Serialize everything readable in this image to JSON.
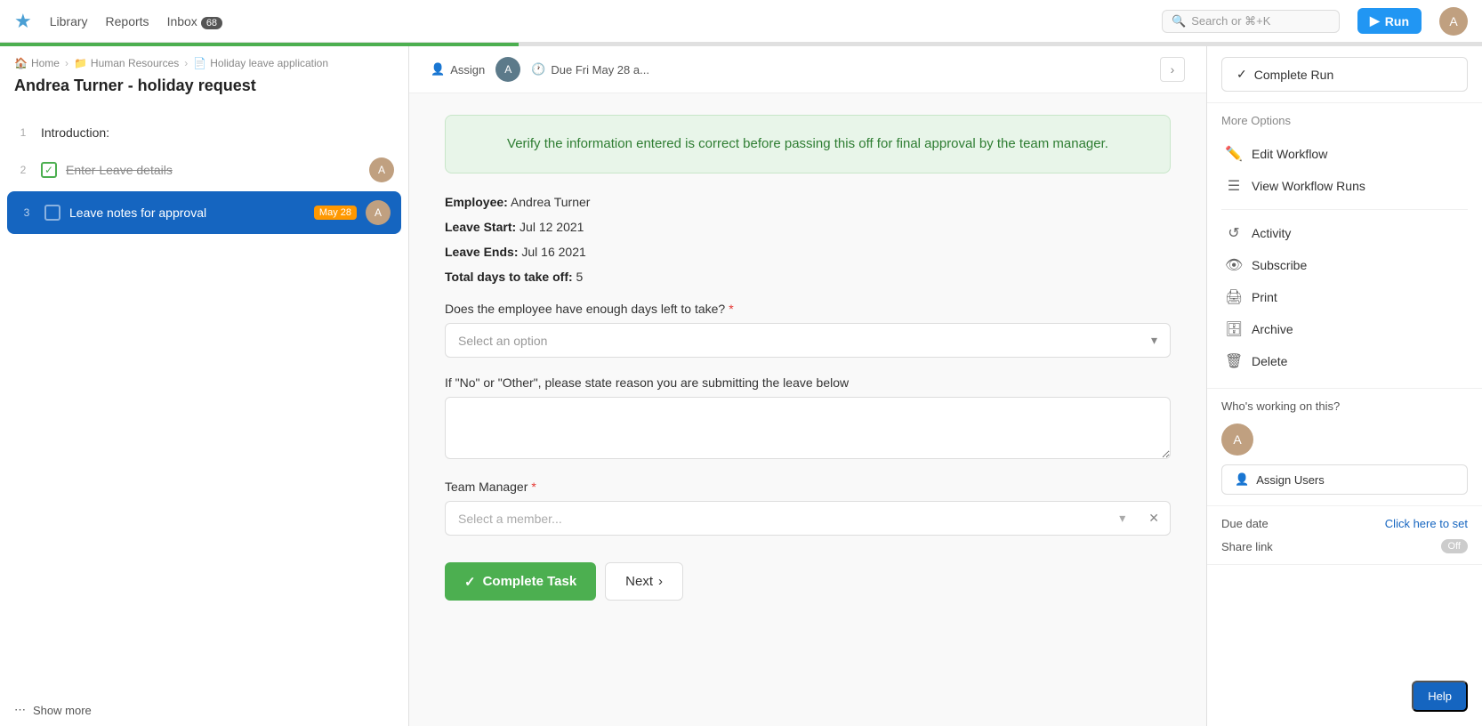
{
  "nav": {
    "logo": "★",
    "links": [
      {
        "label": "Library",
        "id": "library"
      },
      {
        "label": "Reports",
        "id": "reports"
      },
      {
        "label": "Inbox",
        "id": "inbox",
        "badge": "68"
      }
    ],
    "search_placeholder": "Search or ⌘+K",
    "run_label": "Run",
    "user_initial": "A"
  },
  "breadcrumb": {
    "home": "Home",
    "section": "Human Resources",
    "page": "Holiday leave application"
  },
  "page_title": "Andrea Turner - holiday request",
  "steps": [
    {
      "number": "1",
      "label": "Introduction:",
      "completed": false,
      "active": false,
      "checkbox": "none"
    },
    {
      "number": "2",
      "label": "Enter Leave details",
      "completed": true,
      "active": false,
      "checkbox": "checked"
    },
    {
      "number": "3",
      "label": "Leave notes for approval",
      "completed": false,
      "active": true,
      "checkbox": "active",
      "badge": "May 28"
    }
  ],
  "show_more": "Show more",
  "top_bar": {
    "assign_label": "Assign",
    "due_label": "Due Fri May 28 a..."
  },
  "info_banner": {
    "text": "Verify the information entered is correct before passing this off for final approval by the team manager."
  },
  "employee_info": {
    "employee_label": "Employee:",
    "employee_value": "Andrea Turner",
    "leave_start_label": "Leave Start:",
    "leave_start_value": "Jul 12 2021",
    "leave_ends_label": "Leave Ends:",
    "leave_ends_value": "Jul 16 2021",
    "total_days_label": "Total days to take off:",
    "total_days_value": "5"
  },
  "form": {
    "question_label": "Does the employee have enough days left to take?",
    "question_required": true,
    "select_placeholder": "Select an option",
    "reason_label": "If \"No\" or \"Other\", please state reason you are submitting the leave below",
    "reason_placeholder": "",
    "team_manager_label": "Team Manager",
    "team_manager_required": true,
    "member_placeholder": "Select a member...",
    "complete_task_label": "Complete Task",
    "next_label": "Next"
  },
  "right_sidebar": {
    "complete_run_label": "Complete Run",
    "more_options_label": "More Options",
    "menu_items": [
      {
        "id": "edit-workflow",
        "icon": "✏️",
        "label": "Edit Workflow"
      },
      {
        "id": "view-workflow-runs",
        "icon": "☰",
        "label": "View Workflow Runs"
      },
      {
        "id": "activity",
        "icon": "↺",
        "label": "Activity"
      },
      {
        "id": "subscribe",
        "icon": "👁",
        "label": "Subscribe"
      },
      {
        "id": "print",
        "icon": "🖨",
        "label": "Print"
      },
      {
        "id": "archive",
        "icon": "🗄",
        "label": "Archive"
      },
      {
        "id": "delete",
        "icon": "🗑",
        "label": "Delete"
      }
    ],
    "working_title": "Who's working on this?",
    "assign_users_label": "Assign Users",
    "due_date_label": "Due date",
    "due_date_link": "Click here to set",
    "share_label": "Share link",
    "share_toggle": "Off"
  },
  "help_label": "Help"
}
